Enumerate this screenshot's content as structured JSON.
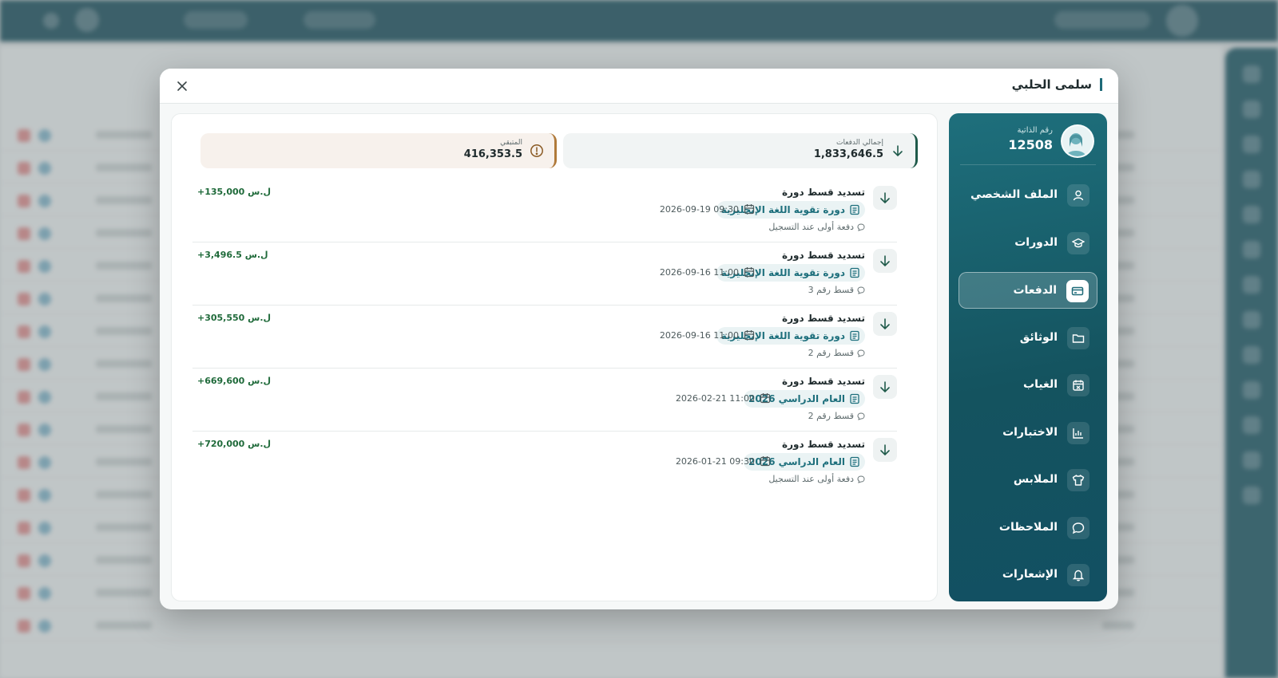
{
  "modal": {
    "title": "سلمى الحلبي"
  },
  "profile": {
    "id_label": "رقم الذاتية",
    "id_value": "12508"
  },
  "sidebar": {
    "items": [
      {
        "label": "الملف الشخصي",
        "icon": "user-icon",
        "active": false
      },
      {
        "label": "الدورات",
        "icon": "graduation-cap-icon",
        "active": false
      },
      {
        "label": "الدفعات",
        "icon": "credit-card-icon",
        "active": true
      },
      {
        "label": "الوثائق",
        "icon": "folder-icon",
        "active": false
      },
      {
        "label": "الغياب",
        "icon": "calendar-x-icon",
        "active": false
      },
      {
        "label": "الاختبارات",
        "icon": "bar-chart-icon",
        "active": false
      },
      {
        "label": "الملابس",
        "icon": "shirt-icon",
        "active": false
      },
      {
        "label": "الملاحظات",
        "icon": "message-icon",
        "active": false
      },
      {
        "label": "الإشعارات",
        "icon": "bell-icon",
        "active": false
      }
    ]
  },
  "stats": {
    "total_label": "إجمالي الدفعات",
    "total_value": "1,833,646.5",
    "remaining_label": "المتبقي",
    "remaining_value": "416,353.5"
  },
  "payments": [
    {
      "title": "تسديد قسط دورة",
      "tag": "دورة تقوية اللغة الإنجليزية",
      "date": "2026-09-19 09:30",
      "note": "دفعة أولى عند التسجيل",
      "amount": "+135,000 ل.س"
    },
    {
      "title": "تسديد قسط دورة",
      "tag": "دورة تقوية اللغة الإنجليزية",
      "date": "2026-09-16 11:00",
      "note": "قسط رقم 3",
      "amount": "+3,496.5 ل.س"
    },
    {
      "title": "تسديد قسط دورة",
      "tag": "دورة تقوية اللغة الإنجليزية",
      "date": "2026-09-16 11:00",
      "note": "قسط رقم 2",
      "amount": "+305,550 ل.س"
    },
    {
      "title": "تسديد قسط دورة",
      "tag": "العام الدراسي 2026",
      "date": "2026-02-21 11:00",
      "note": "قسط رقم 2",
      "amount": "+669,600 ل.س"
    },
    {
      "title": "تسديد قسط دورة",
      "tag": "العام الدراسي 2026",
      "date": "2026-01-21 09:30",
      "note": "دفعة أولى عند التسجيل",
      "amount": "+720,000 ل.س"
    }
  ],
  "colors": {
    "primary": "#1e6a78",
    "success": "#1f6a3a",
    "warning": "#b07a3a"
  }
}
